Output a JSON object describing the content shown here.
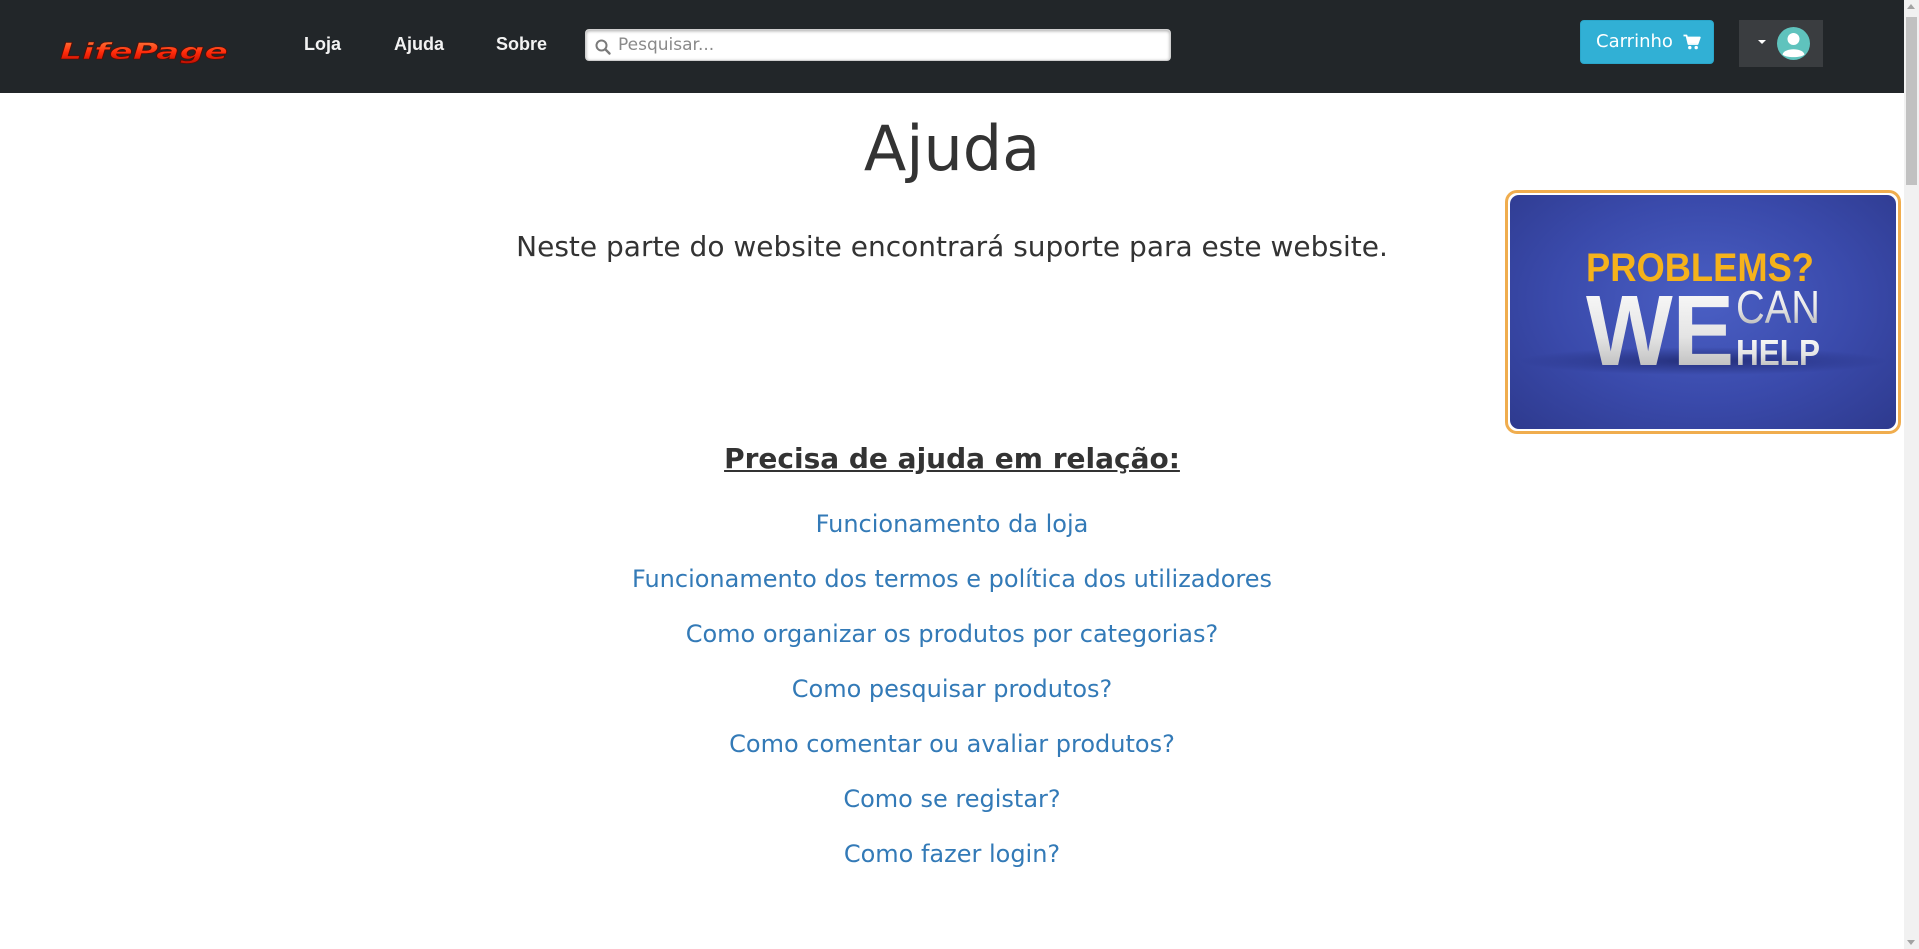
{
  "navbar": {
    "brand_text": "LifePage",
    "links": [
      "Loja",
      "Ajuda",
      "Sobre"
    ],
    "search": {
      "placeholder": "Pesquisar...",
      "value": ""
    },
    "cart_label": "Carrinho",
    "icons": {
      "search": "search-icon",
      "cart": "cart-icon",
      "caret": "caret-down-icon",
      "avatar": "user-avatar-icon"
    }
  },
  "main": {
    "title": "Ajuda",
    "intro": "Neste parte do website encontrará suporte para este website.",
    "help_heading": "Precisa de ajuda em relação:",
    "help_links": [
      "Funcionamento da loja",
      "Funcionamento dos termos e política dos utilizadores",
      "Como organizar os produtos por categorias?",
      "Como pesquisar produtos?",
      "Como comentar ou avaliar produtos?",
      "Como se registar?",
      "Como fazer login?"
    ]
  },
  "promo_banner": {
    "line1": "PROBLEMS?",
    "big_word": "WE",
    "line2": "CAN",
    "line3": "HELP"
  },
  "colors": {
    "navbar_bg": "#222629",
    "cart_button": "#31b0d5",
    "link": "#337ab7",
    "banner_border": "#f0ad4e",
    "banner_bg": "#3a4aab",
    "banner_accent": "#f5b21b"
  }
}
